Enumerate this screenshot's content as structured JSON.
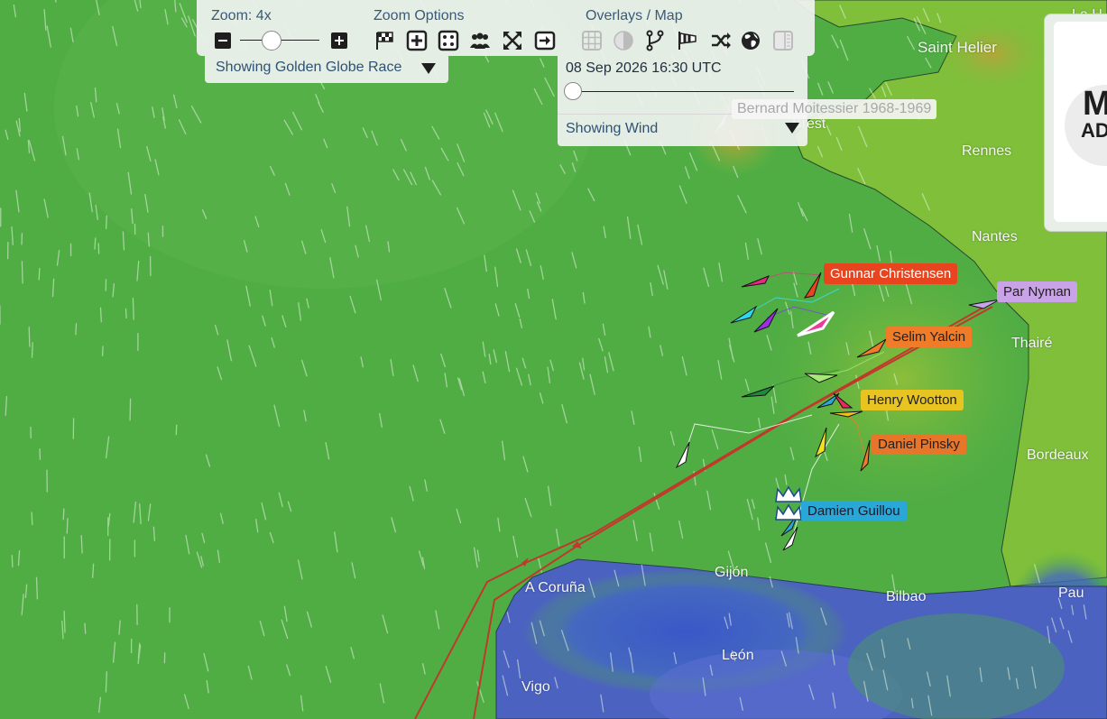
{
  "toolbar": {
    "zoom_label": "Zoom: 4x",
    "zoom_options_label": "Zoom Options",
    "overlays_label": "Overlays / Map",
    "race_selector": "Showing Golden Globe Race",
    "timestamp": "08 Sep 2026 16:30 UTC",
    "layer_selector": "Showing Wind",
    "ghost_label": "Bernard Moitessier 1968-1969"
  },
  "cities": {
    "saint_helier": "Saint Helier",
    "le_h": "Le H",
    "rennes": "Rennes",
    "brest": "Brest",
    "nantes": "Nantes",
    "thaire": "Thairé",
    "bordeaux": "Bordeaux",
    "pau": "Pau",
    "bilbao": "Bilbao",
    "gijon": "Gijón",
    "a_coruna": "A Coruña",
    "leon": "León",
    "vigo": "Vigo"
  },
  "boats": {
    "gunnar": {
      "name": "Gunnar Christensen",
      "color": "#e8441e"
    },
    "par": {
      "name": "Par Nyman",
      "color": "#c9a2e8"
    },
    "selim": {
      "name": "Selim Yalcin",
      "color": "#f07c2a"
    },
    "henry": {
      "name": "Henry Wootton",
      "color": "#e8c420"
    },
    "daniel": {
      "name": "Daniel Pinsky",
      "color": "#e8762a"
    },
    "damien": {
      "name": "Damien Guillou",
      "color": "#29a8d8"
    }
  },
  "ad_badge": {
    "text_top": "M",
    "text_bottom": "AD"
  },
  "colors": {
    "ocean": "#4fae45",
    "land": "#7cba3a",
    "track": "#c0392b",
    "panel_text": "#3a5a7a"
  }
}
